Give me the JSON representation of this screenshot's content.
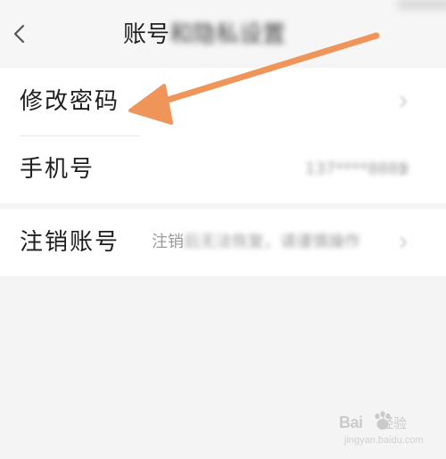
{
  "header": {
    "title_visible": "账号",
    "title_obscured": "和隐私设置"
  },
  "settings": {
    "change_password": {
      "label": "修改密码"
    },
    "phone": {
      "label": "手机号",
      "value_obscured": "137****8888"
    },
    "cancel_account": {
      "label": "注销账号",
      "value_prefix": "注销",
      "value_obscured": "后无法恢复，请谨慎操作"
    }
  },
  "annotation": {
    "arrow_color": "#f0955a"
  },
  "watermark": {
    "text_main": "Bai",
    "text_side": "经验",
    "text_sub": "jingyan.baidu.com"
  }
}
